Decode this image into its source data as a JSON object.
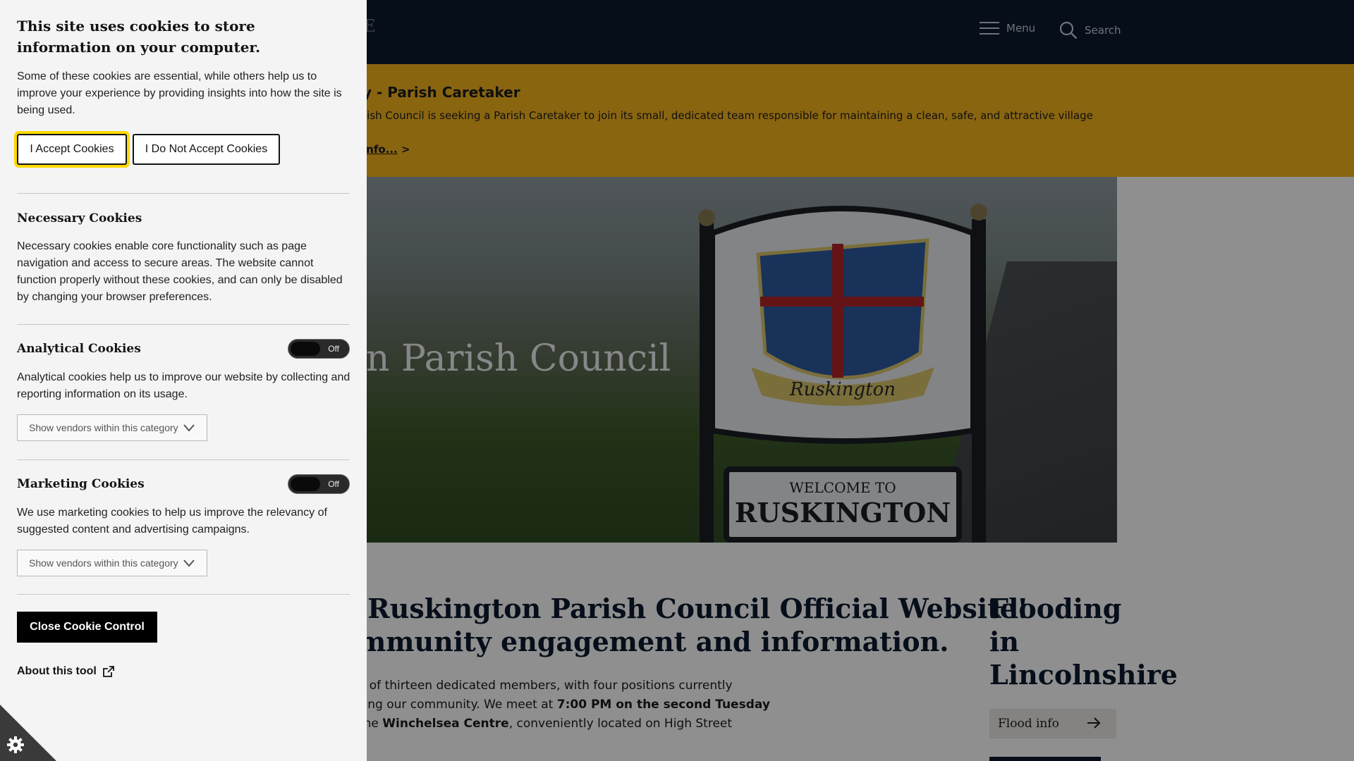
{
  "site": {
    "logo_fragment": "E",
    "header": {
      "menu_label": "Menu",
      "search_label": "Search"
    },
    "alert": {
      "title": "y - Parish Caretaker",
      "body": "rish Council is seeking a Parish Caretaker to join its small, dedicated team responsible for maintaining a clean, safe, and attractive village",
      "link_text": "info...",
      "link_suffix": ">"
    },
    "hero": {
      "title": "ngton Parish Council",
      "sign_welcome": "WELCOME TO",
      "sign_name": "RUSKINGTON",
      "crest_script": "Ruskington"
    },
    "welcome": {
      "line1": "o the Ruskington Parish Council Official Website!",
      "line2": "or community engagement and information.",
      "p_line1": "cil is made up of thirteen dedicated members, with four positions currently",
      "p_line2_a": "rested in serving our community. We meet at ",
      "p_line2_b": "7:00 PM on the second Tuesday",
      "p_line3_a": "n August, at the ",
      "p_line3_b": "Winchelsea Centre",
      "p_line3_c": ", conveniently located on High Street"
    },
    "flood": {
      "heading_1": "Flooding",
      "heading_2": "in",
      "heading_3": "Lincolnshire",
      "button_label": "Flood info"
    }
  },
  "cookie_panel": {
    "title": "This site uses cookies to store information on your computer.",
    "intro": "Some of these cookies are essential, while others help us to improve your experience by providing insights into how the site is being used.",
    "accept_label": "I Accept Cookies",
    "reject_label": "I Do Not Accept Cookies",
    "sections": {
      "necessary": {
        "heading": "Necessary Cookies",
        "text": "Necessary cookies enable core functionality such as page navigation and access to secure areas. The website cannot function properly without these cookies, and can only be disabled by changing your browser preferences."
      },
      "analytical": {
        "heading": "Analytical Cookies",
        "toggle_label": "Off",
        "text": "Analytical cookies help us to improve our website by collecting and reporting information on its usage.",
        "vendors_label": "Show vendors within this category"
      },
      "marketing": {
        "heading": "Marketing Cookies",
        "toggle_label": "Off",
        "text": "We use marketing cookies to help us improve the relevancy of suggested content and advertising campaigns.",
        "vendors_label": "Show vendors within this category"
      }
    },
    "close_label": "Close Cookie Control",
    "about_label": "About this tool"
  },
  "colors": {
    "header_bg": "#0c1a2f",
    "alert_bg": "#f5b51e",
    "accept_focus_ring": "#ffd900",
    "panel_bg": "#f4f4f4",
    "close_button_bg": "#000000"
  },
  "icons": [
    "hamburger-menu-icon",
    "search-icon",
    "arrow-right-icon",
    "chevron-down-icon",
    "external-link-icon",
    "cookie-gear-icon"
  ]
}
